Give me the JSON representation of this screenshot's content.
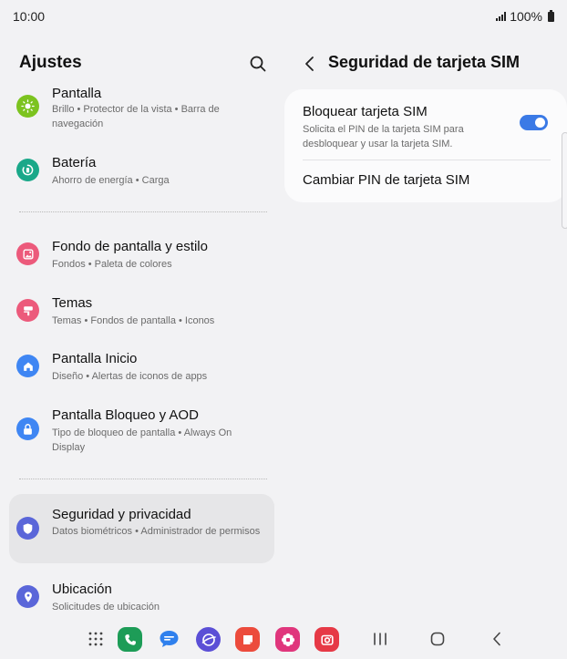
{
  "status_bar": {
    "time": "10:00",
    "battery": "100%"
  },
  "left_pane": {
    "title": "Ajustes",
    "items": [
      {
        "title": "Pantalla",
        "subtitle": "Brillo  •  Protector de la vista  •  Barra de navegación",
        "icon": "sun-icon",
        "color": "#7cc31f"
      },
      {
        "title": "Batería",
        "subtitle": "Ahorro de energía  •  Carga",
        "icon": "battery-icon",
        "color": "#1aa889"
      },
      {
        "title": "Fondo de pantalla y estilo",
        "subtitle": "Fondos  •  Paleta de colores",
        "icon": "wallpaper-icon",
        "color": "#ec5a7b"
      },
      {
        "title": "Temas",
        "subtitle": "Temas  •  Fondos de pantalla  •  Iconos",
        "icon": "brush-icon",
        "color": "#ec5a7b"
      },
      {
        "title": "Pantalla Inicio",
        "subtitle": "Diseño  •  Alertas de iconos de apps",
        "icon": "home-icon",
        "color": "#3f86f3"
      },
      {
        "title": "Pantalla Bloqueo y AOD",
        "subtitle": "Tipo de bloqueo de pantalla  •  Always On Display",
        "icon": "lock-icon",
        "color": "#3f86f3"
      },
      {
        "title": "Seguridad y privacidad",
        "subtitle": "Datos biométricos  •  Administrador de permisos",
        "icon": "shield-icon",
        "color": "#5a66d9"
      },
      {
        "title": "Ubicación",
        "subtitle": "Solicitudes de ubicación",
        "icon": "location-icon",
        "color": "#5a66d9"
      }
    ]
  },
  "right_pane": {
    "title": "Seguridad de tarjeta SIM",
    "lock_sim": {
      "title": "Bloquear tarjeta SIM",
      "subtitle": "Solicita el PIN de la tarjeta SIM para desbloquear y usar la tarjeta SIM.",
      "enabled": true
    },
    "change_pin": {
      "title": "Cambiar PIN de tarjeta SIM"
    }
  },
  "colors": {
    "toggle_on": "#3b7ae6",
    "selected_bg": "#e6e6e8",
    "background": "#f2f2f4",
    "card": "#fbfbfc"
  },
  "dock": [
    "phone-app-icon",
    "messages-app-icon",
    "internet-app-icon",
    "notes-app-icon",
    "gallery-app-icon",
    "camera-app-icon"
  ]
}
